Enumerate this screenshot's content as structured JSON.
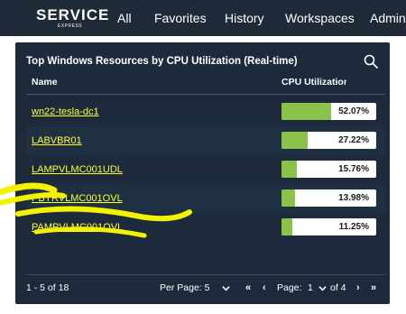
{
  "nav": {
    "logo_main": "SERVICE",
    "logo_sub": "EXPRESS",
    "items": [
      "All",
      "Favorites",
      "History",
      "Workspaces",
      "Admin"
    ]
  },
  "widget": {
    "title": "Top Windows Resources by CPU Utilization (Real-time)",
    "columns": [
      "Name",
      "CPU Utilization"
    ],
    "rows": [
      {
        "name": "wn22-tesla-dc1",
        "cpu": "52.07%",
        "value": 52.07
      },
      {
        "name": "LABVBR01",
        "cpu": "27.22%",
        "value": 27.22
      },
      {
        "name": "LAMPVLMC001UDL",
        "cpu": "15.76%",
        "value": 15.76
      },
      {
        "name": "PBYRVLMC001OVL",
        "cpu": "13.98%",
        "value": 13.98
      },
      {
        "name": "PAMPVLMC001OVL",
        "cpu": "11.25%",
        "value": 11.25
      }
    ],
    "range_text": "1 - 5 of 18",
    "per_page_label": "Per Page: 5",
    "page_label": "Page:",
    "page_value": "1",
    "of_pages": "of 4"
  },
  "colors": {
    "nav_bg": "#1e2a38",
    "widget_bg": "#1c2a3b",
    "link": "#ffff2e",
    "bar_fill": "#8bc34a",
    "highlighter": "#f3f300"
  },
  "icons": [
    "search-icon",
    "chevron-down-icon",
    "first-page-icon",
    "prev-page-icon",
    "next-page-icon",
    "last-page-icon"
  ]
}
